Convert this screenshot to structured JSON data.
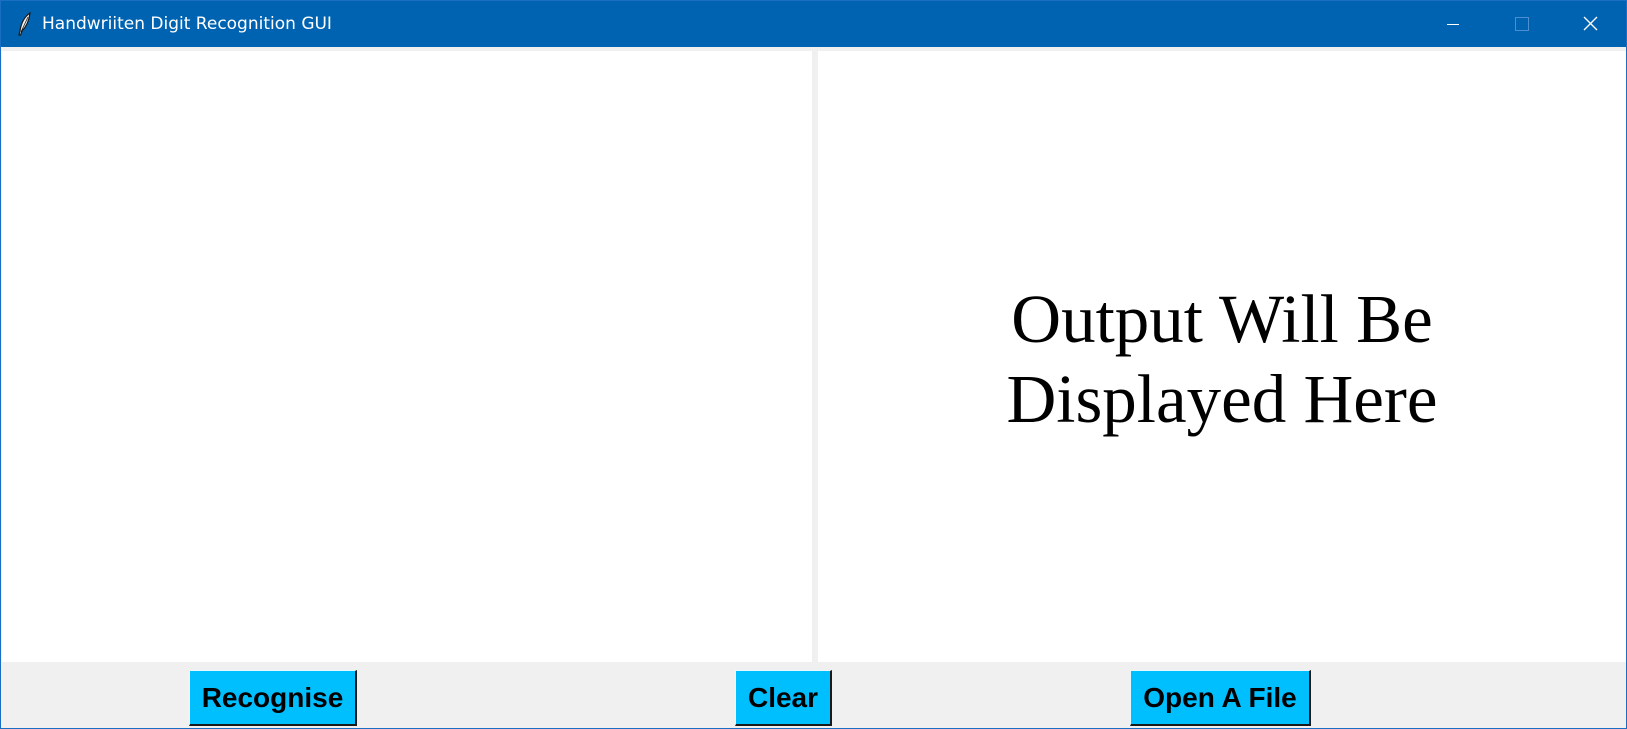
{
  "window": {
    "title": "Handwriiten Digit Recognition GUI",
    "icon": "feather-icon",
    "controls": [
      "minimize-icon",
      "maximize-icon",
      "close-icon"
    ]
  },
  "output": {
    "line1": "Output Will Be",
    "line2": "Displayed Here"
  },
  "buttons": {
    "recognise": "Recognise",
    "clear": "Clear",
    "open_file": "Open A File"
  },
  "colors": {
    "titlebar": "#0063b1",
    "button": "#00bfff",
    "panel": "#ffffff",
    "background": "#f0f0f0"
  }
}
